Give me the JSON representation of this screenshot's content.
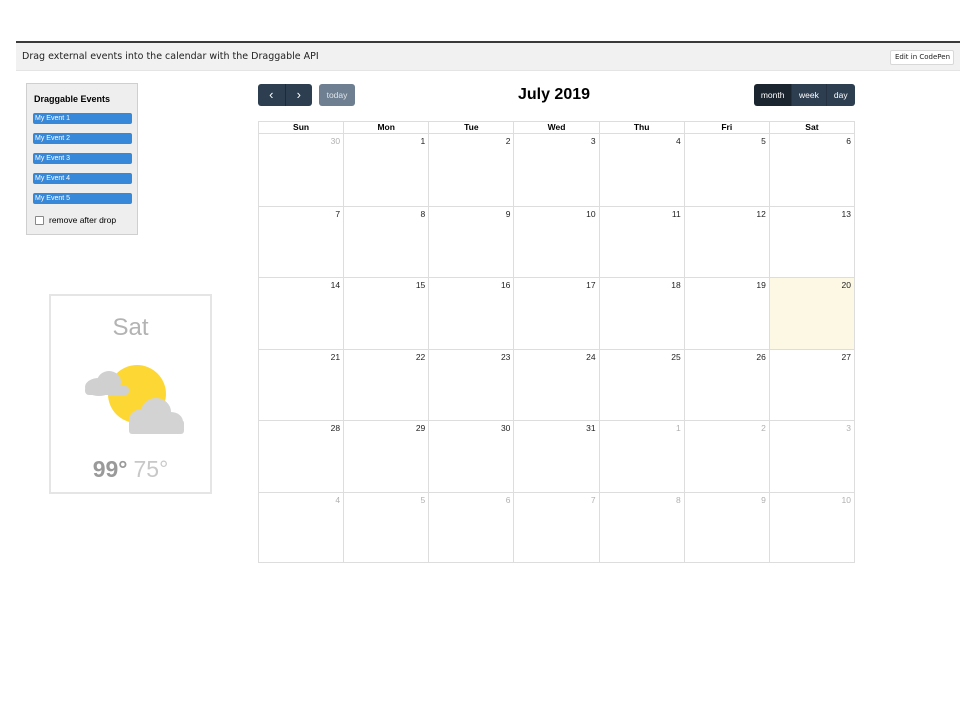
{
  "header": {
    "title": "Drag external events into the calendar with the Draggable API",
    "codepen_label": "Edit in CodePen"
  },
  "external_events": {
    "title": "Draggable Events",
    "events": [
      "My Event 1",
      "My Event 2",
      "My Event 3",
      "My Event 4",
      "My Event 5"
    ],
    "remove_after_drop_label": "remove after drop",
    "remove_after_drop_checked": false,
    "event_color": "#3788d8"
  },
  "weather": {
    "day": "Sat",
    "high": "99°",
    "low": "75°",
    "icon": "partly-cloudy-icon"
  },
  "toolbar": {
    "prev_icon": "‹",
    "next_icon": "›",
    "today_label": "today",
    "title": "July 2019",
    "views": [
      "month",
      "week",
      "day"
    ],
    "active_view": "month",
    "button_color": "#2c3e50"
  },
  "calendar": {
    "day_names": [
      "Sun",
      "Mon",
      "Tue",
      "Wed",
      "Thu",
      "Fri",
      "Sat"
    ],
    "weeks": [
      [
        {
          "n": "30",
          "other": true
        },
        {
          "n": "1"
        },
        {
          "n": "2"
        },
        {
          "n": "3"
        },
        {
          "n": "4"
        },
        {
          "n": "5"
        },
        {
          "n": "6"
        }
      ],
      [
        {
          "n": "7"
        },
        {
          "n": "8"
        },
        {
          "n": "9"
        },
        {
          "n": "10"
        },
        {
          "n": "11"
        },
        {
          "n": "12"
        },
        {
          "n": "13"
        }
      ],
      [
        {
          "n": "14"
        },
        {
          "n": "15"
        },
        {
          "n": "16"
        },
        {
          "n": "17"
        },
        {
          "n": "18"
        },
        {
          "n": "19"
        },
        {
          "n": "20",
          "today": true
        }
      ],
      [
        {
          "n": "21"
        },
        {
          "n": "22"
        },
        {
          "n": "23"
        },
        {
          "n": "24"
        },
        {
          "n": "25"
        },
        {
          "n": "26"
        },
        {
          "n": "27"
        }
      ],
      [
        {
          "n": "28"
        },
        {
          "n": "29"
        },
        {
          "n": "30"
        },
        {
          "n": "31"
        },
        {
          "n": "1",
          "other": true
        },
        {
          "n": "2",
          "other": true
        },
        {
          "n": "3",
          "other": true
        }
      ],
      [
        {
          "n": "4",
          "other": true
        },
        {
          "n": "5",
          "other": true
        },
        {
          "n": "6",
          "other": true
        },
        {
          "n": "7",
          "other": true
        },
        {
          "n": "8",
          "other": true
        },
        {
          "n": "9",
          "other": true
        },
        {
          "n": "10",
          "other": true
        }
      ]
    ],
    "today_color": "#fcf8e3"
  }
}
